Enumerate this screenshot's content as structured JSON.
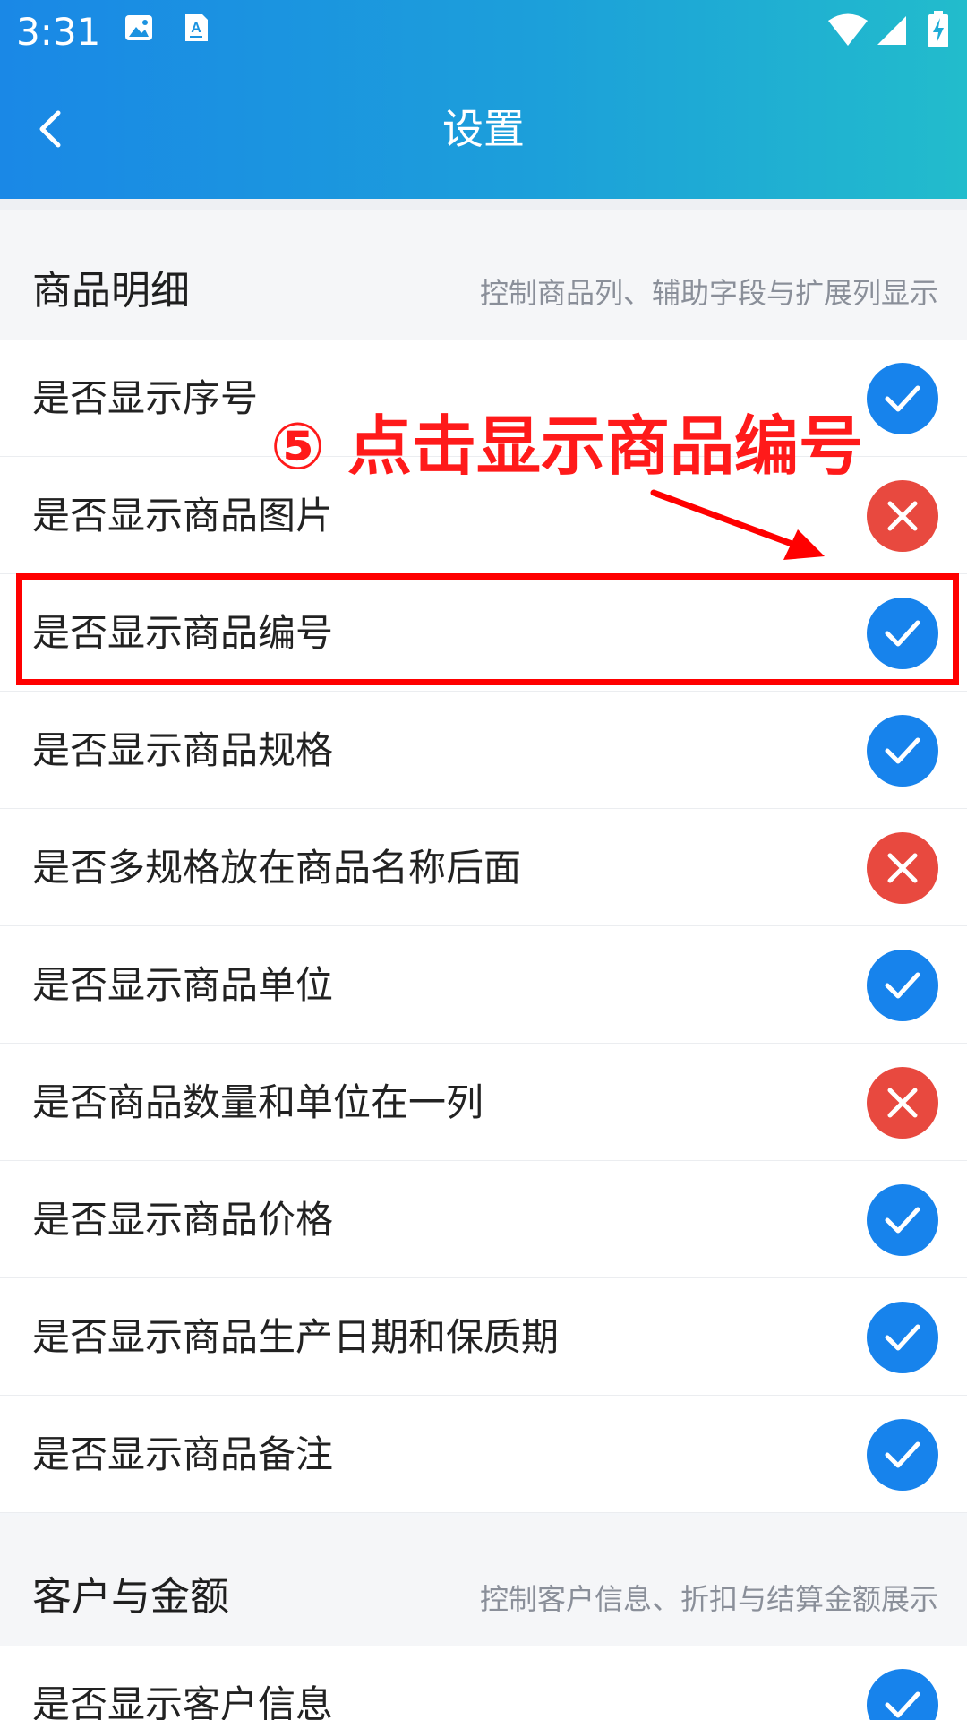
{
  "status_bar": {
    "time": "3:31"
  },
  "header": {
    "title": "设置"
  },
  "sections": [
    {
      "title": "商品明细",
      "description": "控制商品列、辅助字段与扩展列显示",
      "items": [
        {
          "label": "是否显示序号",
          "state": "on"
        },
        {
          "label": "是否显示商品图片",
          "state": "off"
        },
        {
          "label": "是否显示商品编号",
          "state": "on"
        },
        {
          "label": "是否显示商品规格",
          "state": "on"
        },
        {
          "label": "是否多规格放在商品名称后面",
          "state": "off"
        },
        {
          "label": "是否显示商品单位",
          "state": "on"
        },
        {
          "label": "是否商品数量和单位在一列",
          "state": "off"
        },
        {
          "label": "是否显示商品价格",
          "state": "on"
        },
        {
          "label": "是否显示商品生产日期和保质期",
          "state": "on"
        },
        {
          "label": "是否显示商品备注",
          "state": "on"
        }
      ]
    },
    {
      "title": "客户与金额",
      "description": "控制客户信息、折扣与结算金额展示",
      "items": [
        {
          "label": "是否显示客户信息",
          "state": "on"
        }
      ]
    }
  ],
  "annotation": {
    "text": "⑤ 点击显示商品编号",
    "color": "#ff0000"
  },
  "colors": {
    "header_gradient_start": "#1a88e6",
    "header_gradient_end": "#22bccc",
    "toggle_on": "#1783ec",
    "toggle_off": "#e8493f"
  }
}
